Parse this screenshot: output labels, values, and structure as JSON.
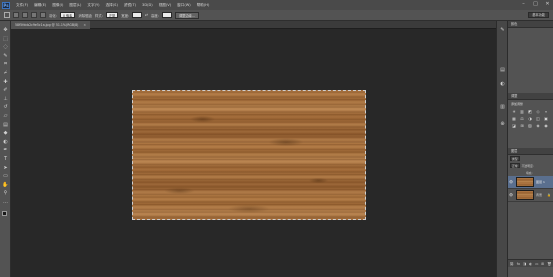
{
  "menubar": {
    "logo": "Ps",
    "items": [
      "文件(F)",
      "编辑(E)",
      "图像(I)",
      "图层(L)",
      "文字(Y)",
      "选择(S)",
      "滤镜(T)",
      "3D(D)",
      "视图(V)",
      "窗口(W)",
      "帮助(H)"
    ],
    "window_controls": [
      "–",
      "□",
      "✕"
    ]
  },
  "options": {
    "feather_label": "羽化:",
    "feather_value": "0 像素",
    "antialias_label": "消除锯齿",
    "style_label": "样式:",
    "style_value": "正常",
    "width_label": "宽度:",
    "height_label": "高度:",
    "refine_button": "调整边缘...",
    "workspace": "基本功能"
  },
  "document": {
    "tab_title": "58f5fdcb2c9e5c1a.jpg @ 51.1%(RGB/8)",
    "close": "×"
  },
  "tools": [
    {
      "name": "move-tool-icon",
      "glyph": "✥"
    },
    {
      "name": "marquee-tool-icon",
      "glyph": "⬚"
    },
    {
      "name": "lasso-tool-icon",
      "glyph": "◌"
    },
    {
      "name": "quick-select-tool-icon",
      "glyph": "✎"
    },
    {
      "name": "crop-tool-icon",
      "glyph": "⌗"
    },
    {
      "name": "eyedropper-tool-icon",
      "glyph": "⌿"
    },
    {
      "name": "healing-brush-tool-icon",
      "glyph": "✚"
    },
    {
      "name": "brush-tool-icon",
      "glyph": "✐"
    },
    {
      "name": "clone-stamp-tool-icon",
      "glyph": "⊥"
    },
    {
      "name": "history-brush-tool-icon",
      "glyph": "↺"
    },
    {
      "name": "eraser-tool-icon",
      "glyph": "▱"
    },
    {
      "name": "gradient-tool-icon",
      "glyph": "▤"
    },
    {
      "name": "blur-tool-icon",
      "glyph": "◆"
    },
    {
      "name": "dodge-tool-icon",
      "glyph": "◐"
    },
    {
      "name": "pen-tool-icon",
      "glyph": "✒"
    },
    {
      "name": "type-tool-icon",
      "glyph": "T"
    },
    {
      "name": "path-select-tool-icon",
      "glyph": "➤"
    },
    {
      "name": "shape-tool-icon",
      "glyph": "▭"
    },
    {
      "name": "hand-tool-icon",
      "glyph": "✋"
    },
    {
      "name": "zoom-tool-icon",
      "glyph": "⚲"
    },
    {
      "name": "more-tools-icon",
      "glyph": "…"
    }
  ],
  "colors": {
    "foreground": "#1a1a1a",
    "background": "#e61e1e",
    "ui_dark": "#282828",
    "ui_panel": "#535353",
    "layer_highlight": "#5a6f8e"
  },
  "panels": {
    "color_tab": "颜色",
    "adjustments_tab": "调整",
    "adjustments_title": "添加调整",
    "adjustment_icons": [
      "☀",
      "▥",
      "◩",
      "◇",
      "▿",
      "▦",
      "⚖",
      "◑",
      "◫",
      "▣",
      "◪",
      "⊞",
      "▨",
      "◈",
      "◉"
    ],
    "layers_tab": "图层",
    "kind_label": "类型",
    "blend_mode": "正常",
    "opacity_label": "不透明度:",
    "fill_label": "填充:",
    "layers": [
      {
        "name": "图层 1",
        "lock": ""
      },
      {
        "name": "背景",
        "lock": "🔒"
      }
    ],
    "footer_icons": [
      "⛓",
      "fx",
      "◨",
      "◐",
      "▭",
      "⊞",
      "🗑"
    ]
  },
  "dock_icons": [
    "✎",
    "▤",
    "◐",
    "▥",
    "⊕"
  ]
}
